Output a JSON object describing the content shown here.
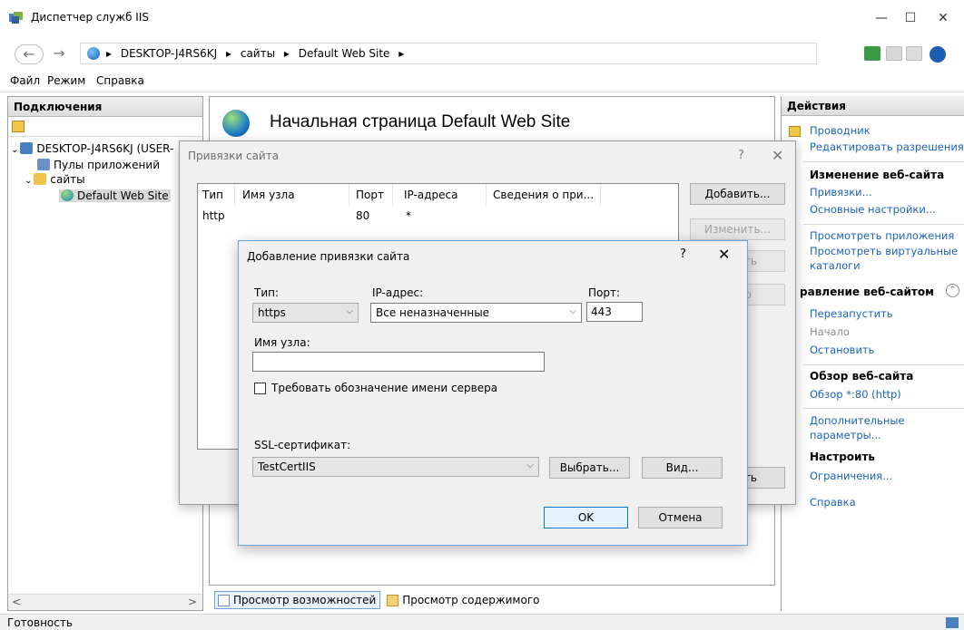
{
  "window": {
    "title": "Диспетчер служб IIS",
    "minimize": "—",
    "maximize": "☐",
    "close": "✕"
  },
  "address": {
    "back": "←",
    "forward": "→",
    "crumbs": [
      "DESKTOP-J4RS6KJ",
      "сайты",
      "Default Web Site"
    ],
    "separator": "▸"
  },
  "menu": [
    "Файл",
    "Режим",
    "Справка"
  ],
  "connections": {
    "header": "Подключения",
    "tree": [
      {
        "label": "DESKTOP-J4RS6KJ (USER-",
        "level": 0,
        "expander": "⌄"
      },
      {
        "label": "Пулы приложений",
        "level": 1,
        "expander": ""
      },
      {
        "label": "сайты",
        "level": 1,
        "expander": "⌄"
      },
      {
        "label": "Default Web Site",
        "level": 2,
        "expander": "",
        "selected": true
      }
    ],
    "scroll_left": "<",
    "scroll_right": ">"
  },
  "center": {
    "title": "Начальная страница Default Web Site",
    "tabs": [
      {
        "label": "Просмотр возможностей",
        "active": true
      },
      {
        "label": "Просмотр содержимого",
        "active": false
      }
    ]
  },
  "actions": {
    "header": "Действия",
    "items": [
      {
        "type": "link",
        "label": "Проводник"
      },
      {
        "type": "link",
        "label": "Редактировать разрешения..."
      },
      {
        "type": "head",
        "label": "Изменение веб-сайта"
      },
      {
        "type": "link",
        "label": "Привязки..."
      },
      {
        "type": "link",
        "label": "Основные настройки..."
      },
      {
        "type": "link",
        "label": "Просмотреть приложения"
      },
      {
        "type": "link",
        "label": "Просмотреть виртуальные"
      },
      {
        "type": "link",
        "label": "каталоги"
      },
      {
        "type": "head",
        "label": "равление веб-сайтом"
      },
      {
        "type": "link",
        "label": "Перезапустить"
      },
      {
        "type": "disabled",
        "label": "Начало"
      },
      {
        "type": "link",
        "label": "Остановить"
      },
      {
        "type": "head",
        "label": "Обзор веб-сайта"
      },
      {
        "type": "link",
        "label": "Обзор *:80 (http)"
      },
      {
        "type": "link",
        "label": "Дополнительные"
      },
      {
        "type": "link",
        "label": "параметры..."
      },
      {
        "type": "head",
        "label": "Настроить"
      },
      {
        "type": "link",
        "label": "Ограничения..."
      },
      {
        "type": "link",
        "label": "Справка"
      }
    ],
    "collapse": "⌃"
  },
  "status": "Готовность",
  "bindings_dialog": {
    "title": "Привязки сайта",
    "help": "?",
    "close": "✕",
    "columns": [
      "Тип",
      "Имя узла",
      "Порт",
      "IP-адреса",
      "Сведения о при..."
    ],
    "rows": [
      {
        "type": "http",
        "host": "",
        "port": "80",
        "ip": "*",
        "info": ""
      }
    ],
    "buttons": {
      "add": "Добавить...",
      "edit": "Изменить...",
      "remove_partial": "ть",
      "browse_partial": "р",
      "close_partial": "ть"
    }
  },
  "add_dialog": {
    "title": "Добавление привязки сайта",
    "help": "?",
    "close": "✕",
    "type_label": "Тип:",
    "type_value": "https",
    "ip_label": "IP-адрес:",
    "ip_value": "Все неназначенные",
    "port_label": "Порт:",
    "port_value": "443",
    "host_label": "Имя узла:",
    "host_value": "",
    "sni_label": "Требовать обозначение имени сервера",
    "sni_checked": false,
    "ssl_label": "SSL-сертификат:",
    "ssl_value": "TestCertIIS",
    "select_button": "Выбрать...",
    "view_button": "Вид...",
    "ok_button": "OK",
    "cancel_button": "Отмена"
  }
}
